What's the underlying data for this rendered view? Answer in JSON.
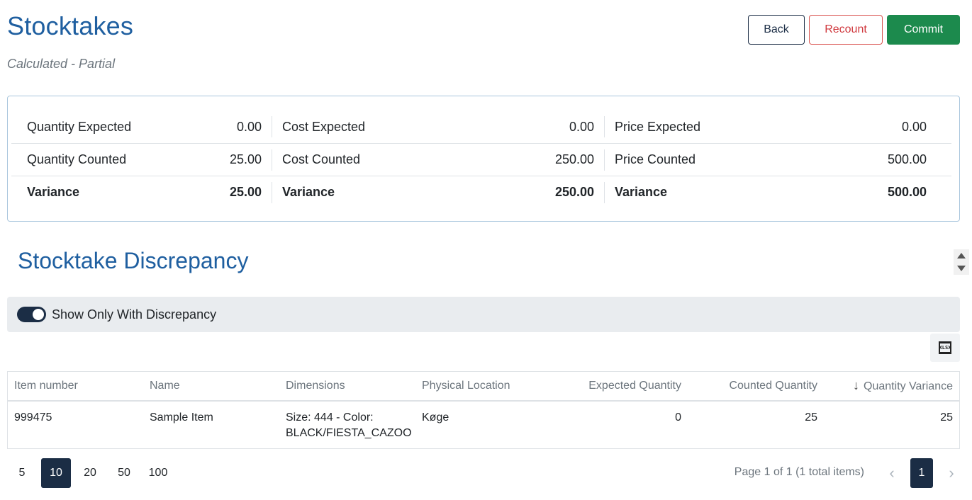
{
  "header": {
    "title": "Stocktakes",
    "subtitle": "Calculated - Partial",
    "back_label": "Back",
    "recount_label": "Recount",
    "commit_label": "Commit"
  },
  "summary": {
    "rows": [
      [
        {
          "label": "Quantity Expected",
          "value": "0.00"
        },
        {
          "label": "Cost Expected",
          "value": "0.00"
        },
        {
          "label": "Price Expected",
          "value": "0.00"
        }
      ],
      [
        {
          "label": "Quantity Counted",
          "value": "25.00"
        },
        {
          "label": "Cost Counted",
          "value": "250.00"
        },
        {
          "label": "Price Counted",
          "value": "500.00"
        }
      ],
      [
        {
          "label": "Variance",
          "value": "25.00"
        },
        {
          "label": "Variance",
          "value": "250.00"
        },
        {
          "label": "Variance",
          "value": "500.00"
        }
      ]
    ]
  },
  "discrepancy": {
    "title": "Stocktake Discrepancy",
    "toggle_label": "Show Only With Discrepancy",
    "toggle_on": true,
    "export_icon": "xlsx-export-icon",
    "export_icon_text": "XLSX"
  },
  "grid": {
    "columns": [
      "Item number",
      "Name",
      "Dimensions",
      "Physical Location",
      "Expected Quantity",
      "Counted Quantity",
      "Quantity Variance"
    ],
    "sort_glyph": "↓",
    "rows": [
      [
        "999475",
        "Sample Item",
        "Size: 444 - Color: BLACK/FIESTA_CAZOO",
        "Køge",
        "0",
        "25",
        "25"
      ]
    ]
  },
  "pager": {
    "sizes": [
      "5",
      "10",
      "20",
      "50",
      "100"
    ],
    "active_size": "10",
    "info": "Page 1 of 1 (1 total items)",
    "current_page": "1",
    "prev_glyph": "‹",
    "next_glyph": "›"
  },
  "colors": {
    "title_blue": "#1f5fa0",
    "navy": "#1b2d45",
    "commit_green": "#1c8a4d",
    "recount_red": "#d0393e"
  }
}
